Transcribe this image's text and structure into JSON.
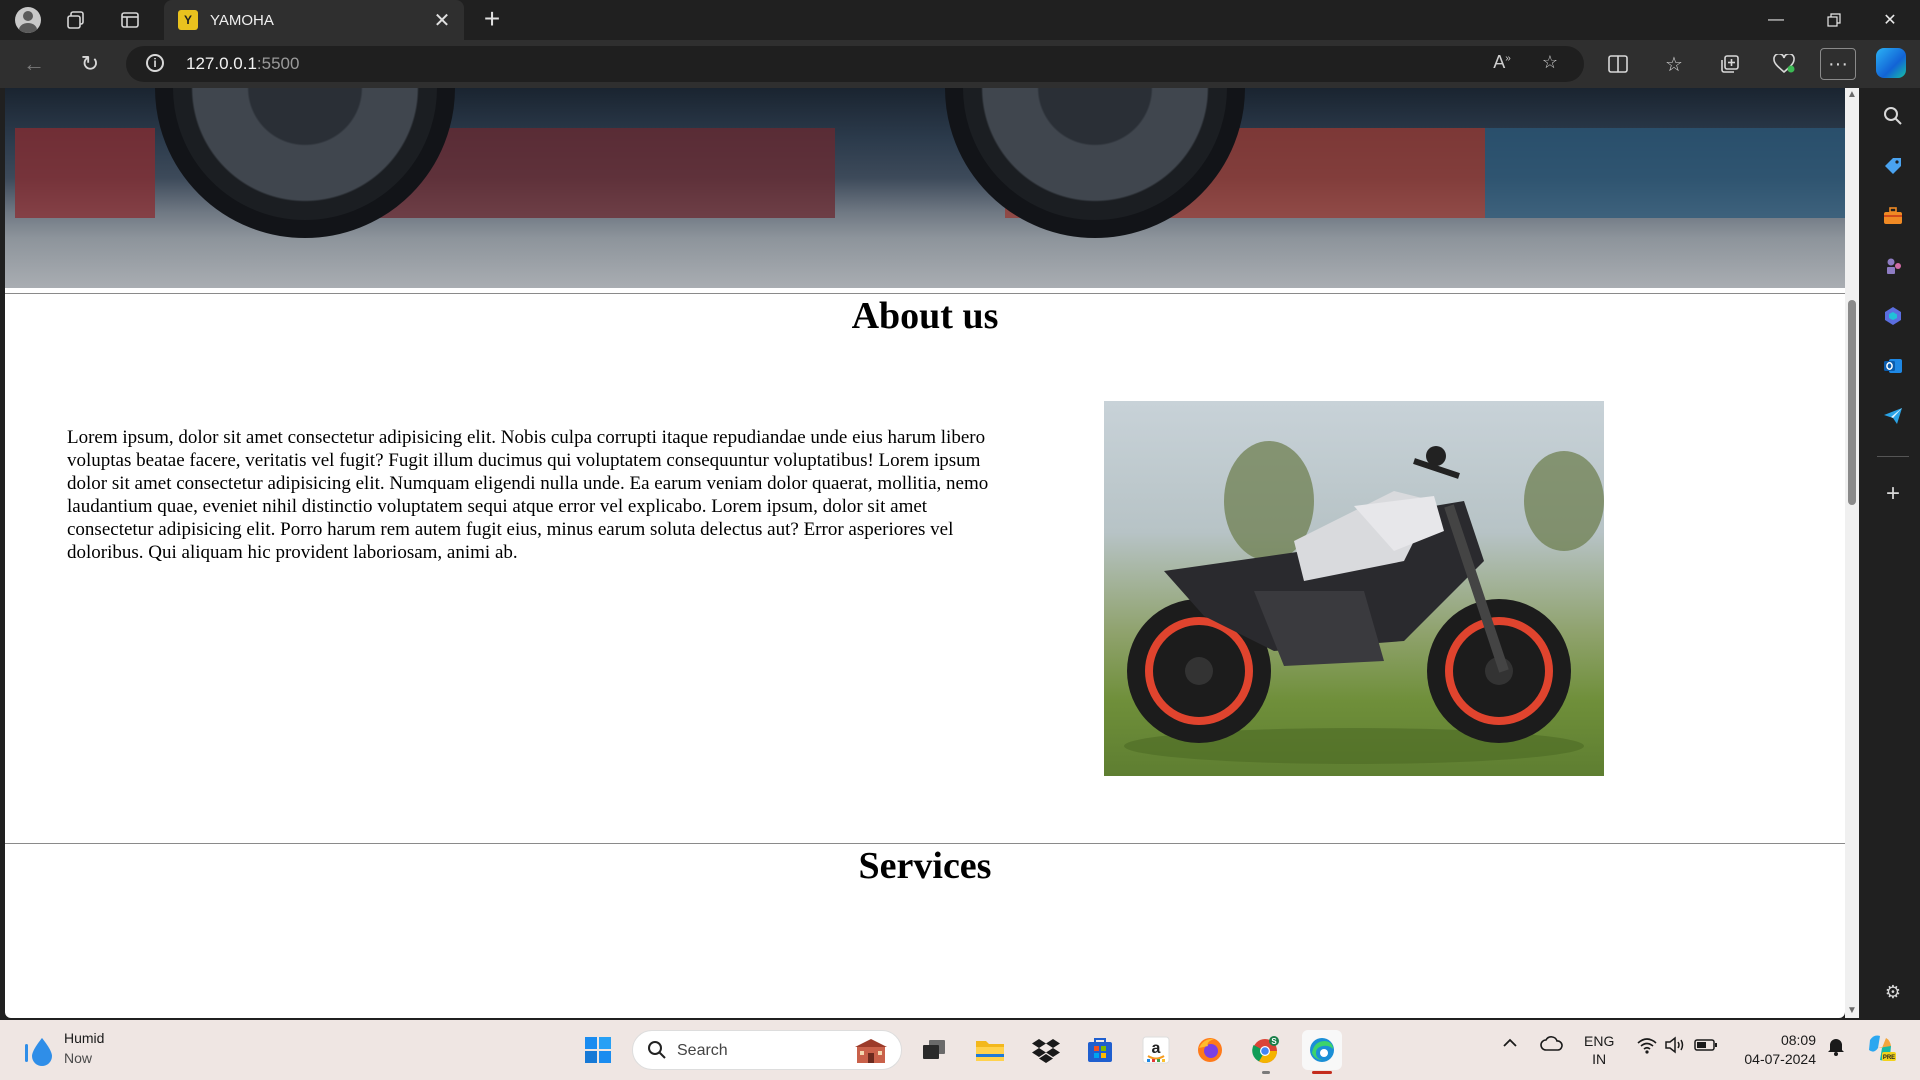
{
  "browser": {
    "tab_title": "YAMOHA",
    "tab_favicon": "Y",
    "url_host": "127.0.0.1",
    "url_port": ":5500"
  },
  "page": {
    "about_heading": "About us",
    "about_text": "Lorem ipsum, dolor sit amet consectetur adipisicing elit. Nobis culpa corrupti itaque repudiandae unde eius harum libero voluptas beatae facere, veritatis vel fugit? Fugit illum ducimus qui voluptatem consequuntur voluptatibus! Lorem ipsum dolor sit amet consectetur adipisicing elit. Numquam eligendi nulla unde. Ea earum veniam dolor quaerat, mollitia, nemo laudantium quae, eveniet nihil distinctio voluptatem sequi atque error vel explicabo. Lorem ipsum, dolor sit amet consectetur adipisicing elit. Porro harum rem autem fugit eius, minus earum soluta delectus aut? Error asperiores vel doloribus. Qui aliquam hic provident laboriosam, animi ab.",
    "services_heading": "Services"
  },
  "taskbar": {
    "weather_title": "Humid",
    "weather_sub": "Now",
    "search_label": "Search",
    "lang_top": "ENG",
    "lang_bottom": "IN",
    "time": "08:09",
    "date": "04-07-2024"
  },
  "colors": {
    "chrome_dark": "#202020",
    "chrome_mid": "#2f2f2f",
    "taskbar": "#efe6e3",
    "accent_blue": "#1a73e8"
  }
}
